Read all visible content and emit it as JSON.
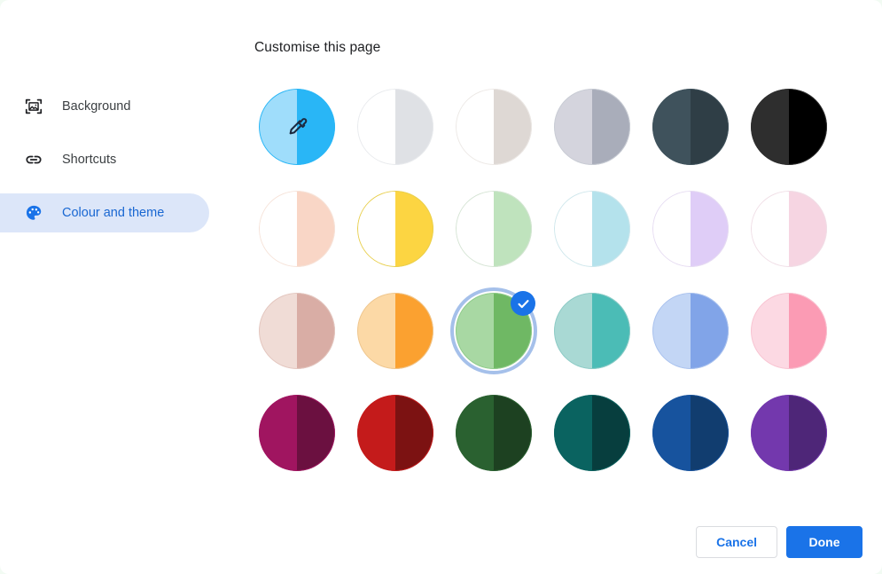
{
  "dialog": {
    "title": "Customise this page",
    "background_color": "#ffffff",
    "page_background_color": "#f2fbf3",
    "accent_color": "#1a73e8"
  },
  "sidebar": {
    "items": [
      {
        "label": "Background",
        "icon": "image-icon",
        "selected": false
      },
      {
        "label": "Shortcuts",
        "icon": "link-icon",
        "selected": false
      },
      {
        "label": "Colour and theme",
        "icon": "palette-icon",
        "selected": true
      }
    ],
    "selected_background_color": "#dce6f9",
    "selected_text_color": "#1967d2"
  },
  "colour_grid": {
    "selected_index": 14,
    "selection_ring_color": "#a5c0ea",
    "check_badge_color": "#1a73e8",
    "rows": [
      [
        {
          "name": "custom-colour-picker",
          "left": "#9fddfb",
          "right": "#29b6f6",
          "border": "#29b6f6",
          "icon": "eyedropper-icon",
          "selected": false
        },
        {
          "name": "white-grey",
          "left": "#ffffff",
          "right": "#dfe1e5",
          "border": "#e8eaed",
          "selected": false
        },
        {
          "name": "white-warm-grey",
          "left": "#ffffff",
          "right": "#ded8d4",
          "border": "#ece8e5",
          "selected": false
        },
        {
          "name": "light-grey-cool",
          "left": "#d4d4dd",
          "right": "#a9adba",
          "border": "#c8ccd4",
          "selected": false
        },
        {
          "name": "slate-dark",
          "left": "#3f525c",
          "right": "#2f3e46",
          "border": "#3f525c",
          "selected": false
        },
        {
          "name": "black",
          "left": "#2e2e2e",
          "right": "#000000",
          "border": "#2e2e2e",
          "selected": false
        }
      ],
      [
        {
          "name": "white-peach",
          "left": "#ffffff",
          "right": "#f9d6c6",
          "border": "#f6e3d9",
          "selected": false
        },
        {
          "name": "white-yellow",
          "left": "#ffffff",
          "right": "#fcd542",
          "border": "#e8cf4e",
          "selected": false
        },
        {
          "name": "white-mint",
          "left": "#ffffff",
          "right": "#bfe3bd",
          "border": "#d5e4d4",
          "selected": false
        },
        {
          "name": "white-cyan",
          "left": "#ffffff",
          "right": "#b4e2ec",
          "border": "#cfe7ec",
          "selected": false
        },
        {
          "name": "white-lavender",
          "left": "#ffffff",
          "right": "#dfcdf7",
          "border": "#e6dcf2",
          "selected": false
        },
        {
          "name": "white-pink",
          "left": "#ffffff",
          "right": "#f6d5e2",
          "border": "#f0dee6",
          "selected": false
        }
      ],
      [
        {
          "name": "blush-rose",
          "left": "#f0dcd6",
          "right": "#d9ada5",
          "border": "#e3c6bf",
          "selected": false
        },
        {
          "name": "peach-orange",
          "left": "#fcd9a6",
          "right": "#fba130",
          "border": "#eec68f",
          "selected": false
        },
        {
          "name": "mint-green",
          "left": "#a8d8a3",
          "right": "#6fb864",
          "border": "#8fcc8a",
          "selected": true
        },
        {
          "name": "pale-teal",
          "left": "#a9d9d4",
          "right": "#4bbcb6",
          "border": "#8ecbc6",
          "selected": false
        },
        {
          "name": "periwinkle-blue",
          "left": "#c3d6f5",
          "right": "#81a4e8",
          "border": "#aac2ee",
          "selected": false
        },
        {
          "name": "pink-rose",
          "left": "#fcd9e3",
          "right": "#fb9bb4",
          "border": "#f8c4d2",
          "selected": false
        }
      ],
      [
        {
          "name": "magenta-dark",
          "left": "#a01560",
          "right": "#6b1040",
          "border": "#a01560",
          "selected": false
        },
        {
          "name": "red-dark",
          "left": "#c41b1b",
          "right": "#7c1212",
          "border": "#c41b1b",
          "selected": false
        },
        {
          "name": "forest-green",
          "left": "#2a6130",
          "right": "#1d4121",
          "border": "#2a6130",
          "selected": false
        },
        {
          "name": "teal-dark",
          "left": "#0a6360",
          "right": "#073e3e",
          "border": "#0a6360",
          "selected": false
        },
        {
          "name": "navy-blue",
          "left": "#17539e",
          "right": "#113d6f",
          "border": "#17539e",
          "selected": false
        },
        {
          "name": "purple-dark",
          "left": "#7338ad",
          "right": "#4e2678",
          "border": "#7338ad",
          "selected": false
        }
      ]
    ]
  },
  "footer": {
    "cancel_label": "Cancel",
    "done_label": "Done"
  }
}
